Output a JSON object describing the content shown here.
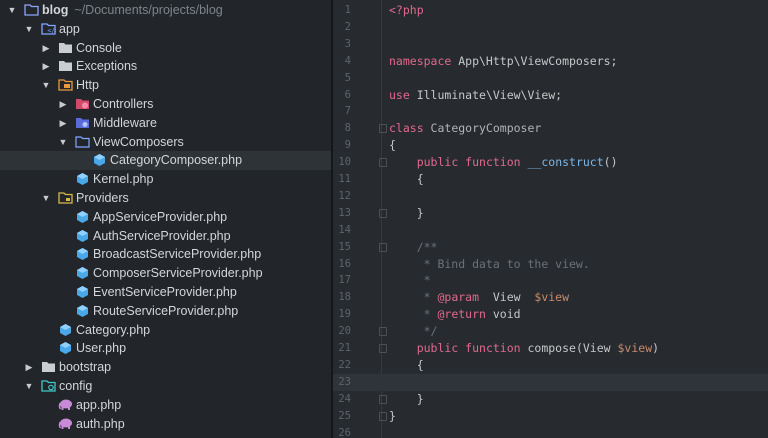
{
  "project": {
    "name": "blog",
    "path": "~/Documents/projects/blog"
  },
  "tree": [
    {
      "label": "blog",
      "path": "~/Documents/projects/blog",
      "depth": 0,
      "arrow": "down",
      "icon": "repo-folder-icon",
      "bold": true
    },
    {
      "label": "app",
      "depth": 1,
      "arrow": "down",
      "icon": "app-folder-icon"
    },
    {
      "label": "Console",
      "depth": 2,
      "arrow": "right",
      "icon": "folder-icon"
    },
    {
      "label": "Exceptions",
      "depth": 2,
      "arrow": "right",
      "icon": "folder-icon"
    },
    {
      "label": "Http",
      "depth": 2,
      "arrow": "down",
      "icon": "http-folder-icon"
    },
    {
      "label": "Controllers",
      "depth": 3,
      "arrow": "right",
      "icon": "controllers-folder-icon"
    },
    {
      "label": "Middleware",
      "depth": 3,
      "arrow": "right",
      "icon": "middleware-folder-icon"
    },
    {
      "label": "ViewComposers",
      "depth": 3,
      "arrow": "down",
      "icon": "folder-outline-icon"
    },
    {
      "label": "CategoryComposer.php",
      "depth": 4,
      "arrow": "",
      "icon": "php-class-icon",
      "selected": true
    },
    {
      "label": "Kernel.php",
      "depth": 3,
      "arrow": "",
      "icon": "php-class-icon"
    },
    {
      "label": "Providers",
      "depth": 2,
      "arrow": "down",
      "icon": "providers-folder-icon"
    },
    {
      "label": "AppServiceProvider.php",
      "depth": 3,
      "arrow": "",
      "icon": "php-class-icon"
    },
    {
      "label": "AuthServiceProvider.php",
      "depth": 3,
      "arrow": "",
      "icon": "php-class-icon"
    },
    {
      "label": "BroadcastServiceProvider.php",
      "depth": 3,
      "arrow": "",
      "icon": "php-class-icon"
    },
    {
      "label": "ComposerServiceProvider.php",
      "depth": 3,
      "arrow": "",
      "icon": "php-class-icon"
    },
    {
      "label": "EventServiceProvider.php",
      "depth": 3,
      "arrow": "",
      "icon": "php-class-icon"
    },
    {
      "label": "RouteServiceProvider.php",
      "depth": 3,
      "arrow": "",
      "icon": "php-class-icon"
    },
    {
      "label": "Category.php",
      "depth": 2,
      "arrow": "",
      "icon": "php-class-icon"
    },
    {
      "label": "User.php",
      "depth": 2,
      "arrow": "",
      "icon": "php-class-icon"
    },
    {
      "label": "bootstrap",
      "depth": 1,
      "arrow": "right",
      "icon": "folder-icon"
    },
    {
      "label": "config",
      "depth": 1,
      "arrow": "down",
      "icon": "config-folder-icon"
    },
    {
      "label": "app.php",
      "depth": 2,
      "arrow": "",
      "icon": "php-elephant-icon"
    },
    {
      "label": "auth.php",
      "depth": 2,
      "arrow": "",
      "icon": "php-elephant-icon"
    }
  ],
  "editor": {
    "current_line": 23,
    "lines": [
      {
        "n": "1",
        "tokens": [
          [
            "tag",
            "<?php"
          ]
        ]
      },
      {
        "n": "2",
        "tokens": []
      },
      {
        "n": "3",
        "tokens": []
      },
      {
        "n": "4",
        "tokens": [
          [
            "kw",
            "namespace"
          ],
          [
            "plain",
            " App\\Http\\ViewComposers;"
          ]
        ]
      },
      {
        "n": "5",
        "tokens": []
      },
      {
        "n": "6",
        "tokens": [
          [
            "kw",
            "use"
          ],
          [
            "plain",
            " Illuminate\\View\\View;"
          ]
        ]
      },
      {
        "n": "7",
        "tokens": []
      },
      {
        "n": "8",
        "fold": true,
        "tokens": [
          [
            "kw",
            "class"
          ],
          [
            "cls",
            " CategoryComposer"
          ]
        ]
      },
      {
        "n": "9",
        "tokens": [
          [
            "plain",
            "{"
          ]
        ]
      },
      {
        "n": "10",
        "fold": true,
        "tokens": [
          [
            "plain",
            "    "
          ],
          [
            "kw",
            "public function"
          ],
          [
            "plain",
            " "
          ],
          [
            "fn",
            "__construct"
          ],
          [
            "plain",
            "()"
          ]
        ]
      },
      {
        "n": "11",
        "tokens": [
          [
            "plain",
            "    {"
          ]
        ]
      },
      {
        "n": "12",
        "tokens": []
      },
      {
        "n": "13",
        "fold": true,
        "tokens": [
          [
            "plain",
            "    }"
          ]
        ]
      },
      {
        "n": "14",
        "tokens": []
      },
      {
        "n": "15",
        "fold": true,
        "tokens": [
          [
            "com",
            "    /**"
          ]
        ]
      },
      {
        "n": "16",
        "tokens": [
          [
            "com",
            "     * Bind data to the view."
          ]
        ]
      },
      {
        "n": "17",
        "tokens": [
          [
            "com",
            "     *"
          ]
        ]
      },
      {
        "n": "18",
        "tokens": [
          [
            "com",
            "     * "
          ],
          [
            "kw",
            "@param"
          ],
          [
            "plain",
            "  View  "
          ],
          [
            "var",
            "$view"
          ]
        ]
      },
      {
        "n": "19",
        "tokens": [
          [
            "com",
            "     * "
          ],
          [
            "kw",
            "@return"
          ],
          [
            "plain",
            " void"
          ]
        ]
      },
      {
        "n": "20",
        "fold": true,
        "tokens": [
          [
            "com",
            "     */"
          ]
        ]
      },
      {
        "n": "21",
        "fold": true,
        "tokens": [
          [
            "plain",
            "    "
          ],
          [
            "kw",
            "public function"
          ],
          [
            "plain",
            " compose(View "
          ],
          [
            "var",
            "$view"
          ],
          [
            "plain",
            ")"
          ]
        ]
      },
      {
        "n": "22",
        "tokens": [
          [
            "plain",
            "    {"
          ]
        ]
      },
      {
        "n": "23",
        "tokens": []
      },
      {
        "n": "24",
        "fold": true,
        "tokens": [
          [
            "plain",
            "    }"
          ]
        ]
      },
      {
        "n": "25",
        "fold": true,
        "tokens": [
          [
            "plain",
            "}"
          ]
        ]
      },
      {
        "n": "26",
        "tokens": []
      }
    ]
  },
  "colors": {
    "sidebar_bg": "#22262b",
    "editor_bg": "#272b30",
    "selected_row": "#2e3338",
    "keyword": "#e0698b",
    "function": "#7eb6e6",
    "variable": "#c88a6a",
    "comment": "#6a7178",
    "php_icon": "#4aa8e8",
    "folder": "#c9ced3",
    "elephant": "#c98bd8"
  }
}
